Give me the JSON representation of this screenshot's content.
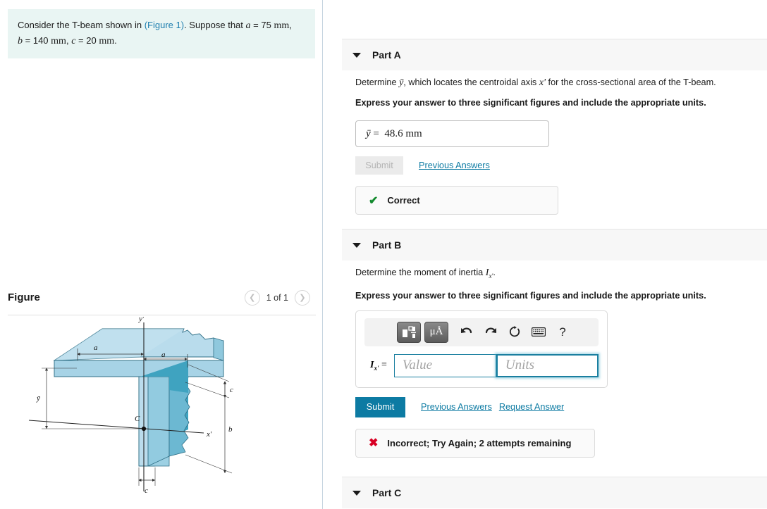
{
  "question": {
    "lead": "Consider the T-beam shown in",
    "figure_link": "(Figure 1)",
    "suppose": ". Suppose that",
    "a_sym": "a",
    "a_eq": "=",
    "a_val": "75",
    "a_unit": "mm",
    "b_sym": "b",
    "b_val": "140",
    "b_unit": "mm",
    "c_sym": "c",
    "c_val": "20",
    "c_unit": "mm",
    "comma": ",",
    "period": "."
  },
  "figure": {
    "title": "Figure",
    "counter": "1 of 1",
    "prev_icon": "chevron-left-icon",
    "next_icon": "chevron-right-icon",
    "labels": {
      "y_axis": "y'",
      "x_axis": "x'",
      "centroid": "C",
      "ybar": "ȳ",
      "a1": "a",
      "a2": "a",
      "b": "b",
      "c_right": "c",
      "c_bottom": "c"
    }
  },
  "parts": {
    "a": {
      "label": "Part A",
      "caret_icon": "caret-down-icon",
      "prompt_1_pre": "Determine ",
      "prompt_1_sym": "ȳ",
      "prompt_1_mid": ", which locates the centroidal axis ",
      "prompt_1_axis": "x'",
      "prompt_1_post": " for the cross-sectional area of the T-beam.",
      "prompt_2": "Express your answer to three significant figures and include the appropriate units.",
      "answer_symbol": "ȳ",
      "answer_equals": "=",
      "answer_value": "48.6 mm",
      "submit_label": "Submit",
      "previous_answers_label": "Previous Answers",
      "feedback_icon": "check-icon",
      "feedback_text": "Correct"
    },
    "b": {
      "label": "Part B",
      "caret_icon": "caret-down-icon",
      "prompt_1_pre": "Determine the moment of inertia ",
      "prompt_1_sym": "I",
      "prompt_1_sub": "x'",
      "prompt_1_post": ".",
      "prompt_2": "Express your answer to three significant figures and include the appropriate units.",
      "toolbar": {
        "template_icon": "math-template-icon",
        "units_icon": "micro-angstrom-icon",
        "units_label": "μÅ",
        "undo_icon": "undo-arrow-icon",
        "redo_icon": "redo-arrow-icon",
        "reset_icon": "reset-circle-icon",
        "keyboard_icon": "keyboard-icon",
        "help_icon": "help-question-icon",
        "help_label": "?"
      },
      "lhs_sym": "I",
      "lhs_sub": "x'",
      "lhs_equals": "=",
      "value_placeholder": "Value",
      "units_placeholder": "Units",
      "value_text": "",
      "units_text": "",
      "submit_label": "Submit",
      "previous_answers_label": "Previous Answers",
      "request_answer_label": "Request Answer",
      "feedback_icon": "x-mark-icon",
      "feedback_text": "Incorrect; Try Again; 2 attempts remaining"
    },
    "c": {
      "label": "Part C",
      "caret_icon": "caret-down-icon"
    }
  },
  "colors": {
    "accent": "#0d7ba3",
    "question_bg": "#e9f5f3",
    "part_header_bg": "#f7f7f7",
    "correct_green": "#138a2e",
    "incorrect_red": "#d80024",
    "beam_light": "#bcdced",
    "beam_mid": "#8ec9de",
    "beam_dark": "#3aa0bd"
  }
}
